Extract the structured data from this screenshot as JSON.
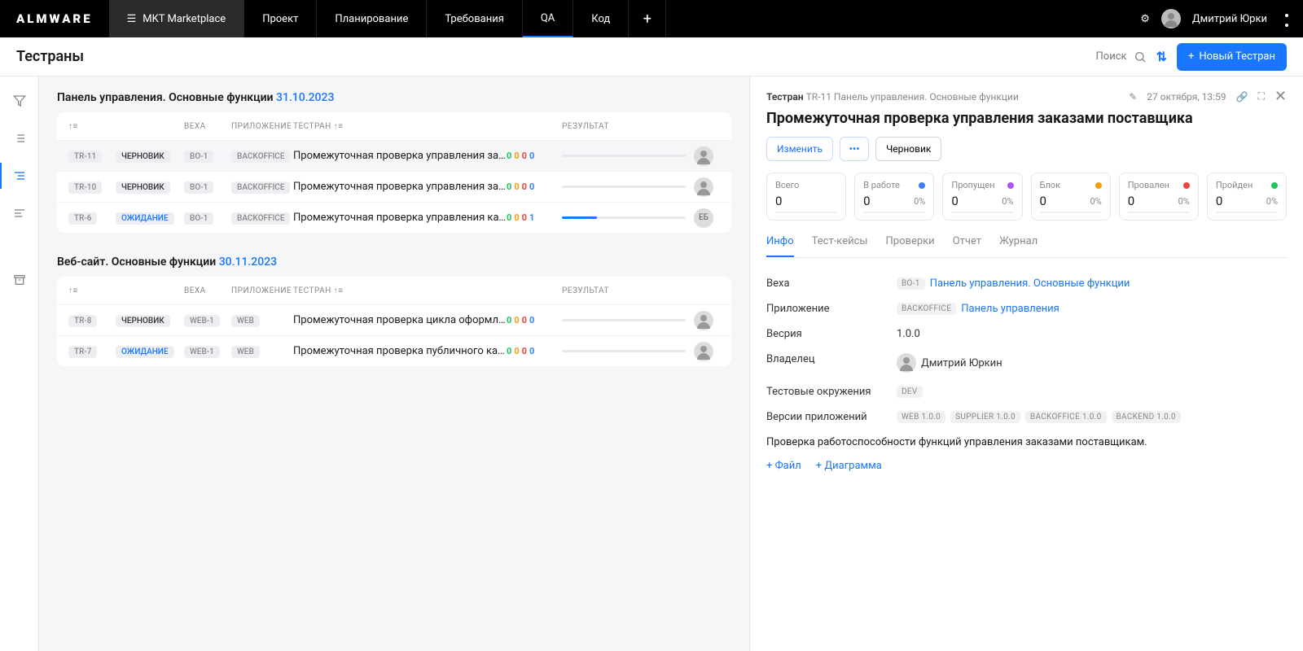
{
  "brand": "ALMWARE",
  "nav": {
    "project": "MKT Marketplace",
    "items": [
      "Проект",
      "Планирование",
      "Требования",
      "QA",
      "Код"
    ],
    "active": "QA"
  },
  "user": "Дмитрий Юрки",
  "page": {
    "title": "Тестраны",
    "searchPlaceholder": "Поиск",
    "newBtn": "Новый Тестран"
  },
  "columns": {
    "veha": "ВЕХА",
    "app": "ПРИЛОЖЕНИЕ",
    "testrun": "ТЕСТРАН",
    "result": "РЕЗУЛЬТАТ"
  },
  "status": {
    "draft": "ЧЕРНОВИК",
    "wait": "ОЖИДАНИЕ"
  },
  "groups": [
    {
      "title": "Панель управления. Основные функции",
      "date": "31.10.2023",
      "rows": [
        {
          "id": "TR-11",
          "status": "draft",
          "veha": "BO-1",
          "app": "BACKOFFICE",
          "name": "Промежуточная проверка управления заказ...",
          "r": [
            0,
            0,
            0,
            0
          ],
          "progress": 0,
          "who": "img",
          "selected": true
        },
        {
          "id": "TR-10",
          "status": "draft",
          "veha": "BO-1",
          "app": "BACKOFFICE",
          "name": "Промежуточная проверка управления заказ...",
          "r": [
            0,
            0,
            0,
            0
          ],
          "progress": 0,
          "who": "img"
        },
        {
          "id": "TR-6",
          "status": "wait",
          "veha": "BO-1",
          "app": "BACKOFFICE",
          "name": "Промежуточная проверка управления катал...",
          "r": [
            0,
            0,
            0,
            1
          ],
          "progress": 28,
          "who": "ЕБ"
        }
      ]
    },
    {
      "title": "Веб-сайт. Основные функции",
      "date": "30.11.2023",
      "rows": [
        {
          "id": "TR-8",
          "status": "draft",
          "veha": "WEB-1",
          "app": "WEB",
          "name": "Промежуточная проверка цикла оформлени...",
          "r": [
            0,
            0,
            0,
            0
          ],
          "progress": 0,
          "who": "img"
        },
        {
          "id": "TR-7",
          "status": "wait",
          "veha": "WEB-1",
          "app": "WEB",
          "name": "Промежуточная проверка публичного катал...",
          "r": [
            0,
            0,
            0,
            0
          ],
          "progress": 0,
          "who": "img"
        }
      ]
    }
  ],
  "detail": {
    "crumbLabel": "Тестран",
    "crumbId": "TR-11 Панель управления. Основные функции",
    "datetime": "27 октября, 13:59",
    "title": "Промежуточная проверка управления заказами поставщика",
    "editBtn": "Изменить",
    "statusBadge": "Черновик",
    "stats": [
      {
        "label": "Всего",
        "val": "0",
        "pct": "",
        "color": ""
      },
      {
        "label": "В работе",
        "val": "0",
        "pct": "0%",
        "color": "#3b82f6"
      },
      {
        "label": "Пропущен",
        "val": "0",
        "pct": "0%",
        "color": "#a855f7"
      },
      {
        "label": "Блок",
        "val": "0",
        "pct": "0%",
        "color": "#f59e0b"
      },
      {
        "label": "Провален",
        "val": "0",
        "pct": "0%",
        "color": "#ef4444"
      },
      {
        "label": "Пройден",
        "val": "0",
        "pct": "0%",
        "color": "#22c55e"
      }
    ],
    "tabs": [
      "Инфо",
      "Тест-кейсы",
      "Проверки",
      "Отчет",
      "Журнал"
    ],
    "activeTab": "Инфо",
    "info": {
      "vehaLabel": "Веха",
      "vehaTag": "BO-1",
      "vehaLink": "Панель управления. Основные функции",
      "appLabel": "Приложение",
      "appTag": "BACKOFFICE",
      "appLink": "Панель управления",
      "versionLabel": "Весрия",
      "version": "1.0.0",
      "ownerLabel": "Владелец",
      "owner": "Дмитрий Юркин",
      "envLabel": "Тестовые окружения",
      "env": "DEV",
      "appVersionsLabel": "Версии приложений",
      "appVersions": [
        "WEB 1.0.0",
        "SUPPLIER 1.0.0",
        "BACKOFFICE 1.0.0",
        "BACKEND 1.0.0"
      ]
    },
    "description": "Проверка работоспособности функций управления заказами поставщикам.",
    "attachFile": "+ Файл",
    "attachDiagram": "+ Диаграмма"
  }
}
